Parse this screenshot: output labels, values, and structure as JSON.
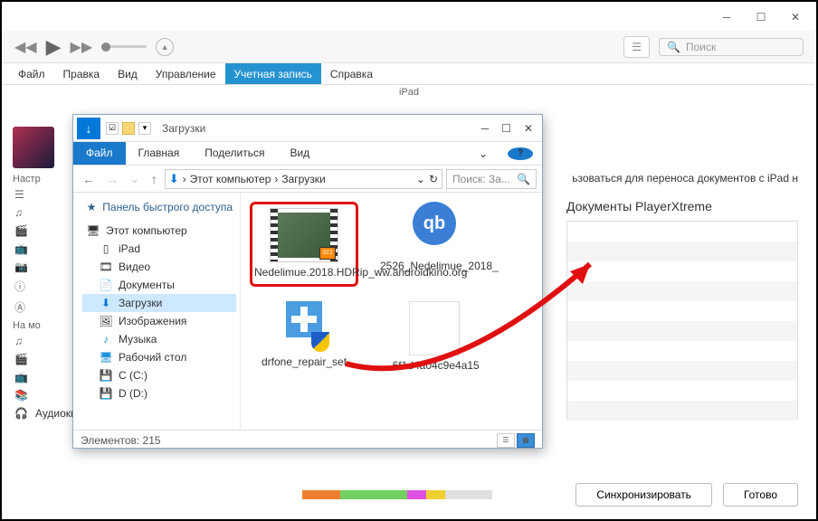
{
  "itunes": {
    "menu": [
      "Файл",
      "Правка",
      "Вид",
      "Управление",
      "Учетная запись",
      "Справка"
    ],
    "menu_active_index": 4,
    "device_header": "iPad",
    "search_placeholder": "Поиск",
    "left": {
      "section1": "Настр",
      "section2": "На мо",
      "audiobooks": "Аудиокниги"
    },
    "right_text": "ьзоваться для переноса документов с iPad н",
    "docpane_title": "Документы PlayerXtreme",
    "sync": "Синхронизировать",
    "done": "Готово"
  },
  "explorer": {
    "title": "Загрузки",
    "ribbon": {
      "file": "Файл",
      "home": "Главная",
      "share": "Поделиться",
      "view": "Вид"
    },
    "address": {
      "pc": "Этот компьютер",
      "folder": "Загрузки"
    },
    "search_placeholder": "Поиск: За...",
    "tree": {
      "quick": "Панель быстрого доступа",
      "pc": "Этот компьютер",
      "ipad": "iPad",
      "video": "Видео",
      "documents": "Документы",
      "downloads": "Загрузки",
      "pictures": "Изображения",
      "music": "Музыка",
      "desktop": "Рабочий стол",
      "c": "C (C:)",
      "d": "D (D:)"
    },
    "files": {
      "f1": "Nedelimue.2018.HDRip_ww.androidkino.org",
      "f2": "2526_Nedelimue_2018_",
      "f3": "drfone_repair_set",
      "f4": ".6f1d4a04c9e4a15"
    },
    "status": "Элементов: 215"
  }
}
